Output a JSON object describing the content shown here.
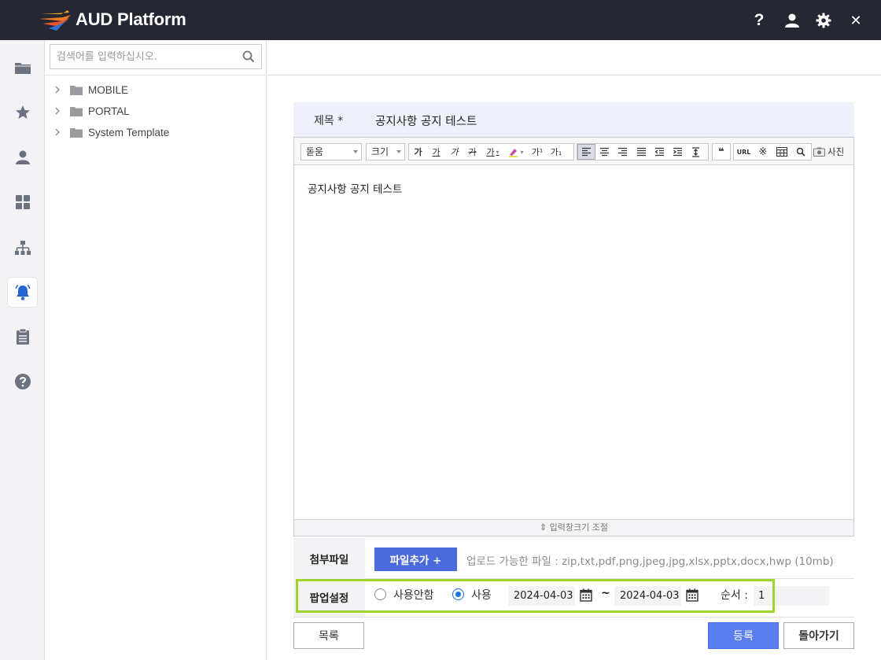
{
  "app": {
    "title": "AUD Platform"
  },
  "titlebar_icons": [
    "help-icon",
    "user-icon",
    "gear-icon",
    "close-icon"
  ],
  "titlebar": {
    "help_glyph": "?",
    "close_glyph": "✕"
  },
  "rail": {
    "items": [
      "folder-icon",
      "star-icon",
      "user-icon",
      "dashboard-icon",
      "org-chart-icon",
      "notification-bell-icon",
      "clipboard-icon",
      "help-icon"
    ],
    "active": "notification-bell-icon"
  },
  "tree": {
    "search_placeholder": "검색어를 입력하십시오.",
    "nodes": [
      {
        "label": "MOBILE"
      },
      {
        "label": "PORTAL"
      },
      {
        "label": "System Template"
      }
    ]
  },
  "form": {
    "title_label": "제목 *",
    "title_value": "공지사항 공지 테스트",
    "editor": {
      "font_select": "돋움",
      "size_select": "크기",
      "format_buttons": [
        "가",
        "가",
        "가",
        "가",
        "가"
      ],
      "script_buttons": [
        "가¹",
        "가₁"
      ],
      "photo_label": "사진",
      "url_label": "URL",
      "quote_glyph": "❝",
      "special_char_glyph": "※",
      "content": "공지사항 공지 테스트",
      "resize_label": "⇕ 입력창크기 조절"
    },
    "attachment": {
      "label": "첨부파일",
      "add_button": "파일추가 +",
      "hint": "업로드 가능한 파일 : zip,txt,pdf,png,jpeg,jpg,xlsx,pptx,docx,hwp (10mb)"
    },
    "popup": {
      "label": "팝업설정",
      "option_off": "사용안함",
      "option_on": "사용",
      "selected": "사용",
      "start_date": "2024-04-03",
      "separator": "~",
      "end_date": "2024-04-03",
      "order_label": "순서 :",
      "order_value": "1"
    },
    "buttons": {
      "list": "목록",
      "submit": "등록",
      "back": "돌아가기"
    }
  },
  "colors": {
    "titlebar": "#252833",
    "accent": "#4b6bdb",
    "submit": "#5a7df2",
    "highlight": "#a3d42c"
  }
}
